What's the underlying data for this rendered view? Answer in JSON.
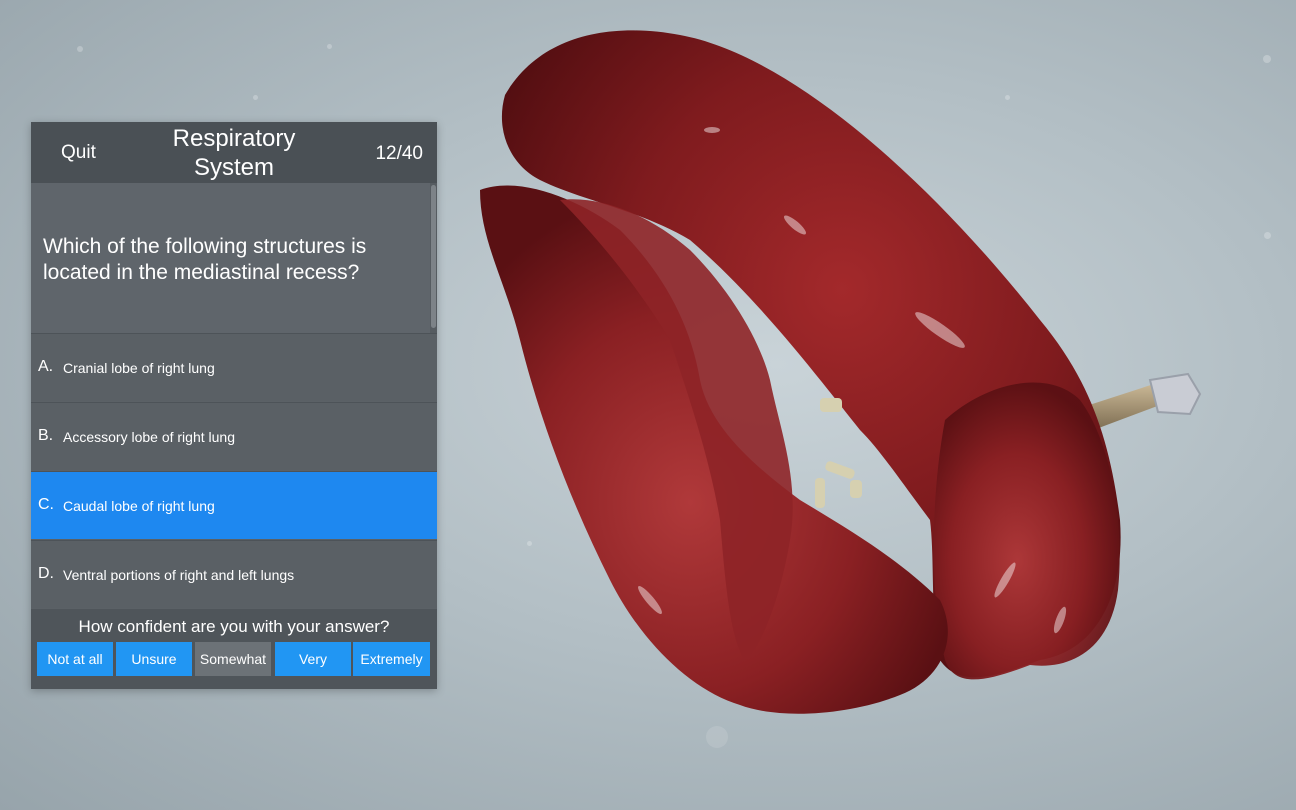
{
  "quiz": {
    "quit_label": "Quit",
    "title": "Respiratory System",
    "progress": "12/40",
    "question": "Which of the following structures is located in the mediastinal recess?",
    "answers": [
      {
        "letter": "A.",
        "label": "Cranial lobe of right lung"
      },
      {
        "letter": "B.",
        "label": "Accessory lobe of right lung"
      },
      {
        "letter": "C.",
        "label": "Caudal lobe of right lung"
      },
      {
        "letter": "D.",
        "label": "Ventral portions of right and left lungs"
      }
    ],
    "selected_answer": "C.",
    "confidence": {
      "prompt": "How confident are you with your answer?",
      "options": [
        "Not at all",
        "Unsure",
        "Somewhat",
        "Very",
        "Extremely"
      ]
    }
  },
  "colors": {
    "accent": "#1e88f0",
    "panel": "#5b6166",
    "lung": "#8c1f22"
  }
}
